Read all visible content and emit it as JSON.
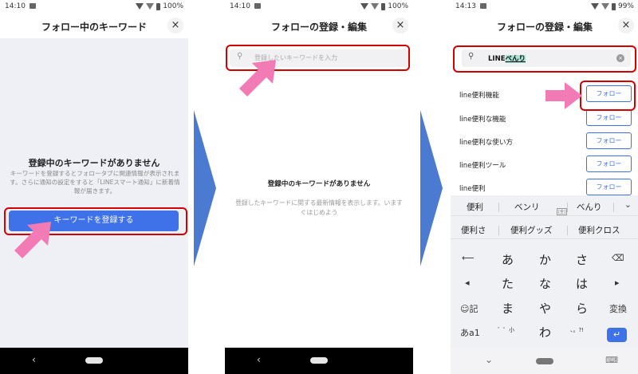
{
  "screen1": {
    "status_time": "14:10",
    "battery": "100%",
    "title": "フォロー中のキーワード",
    "close": "×",
    "empty_title": "登録中のキーワードがありません",
    "empty_desc": "キーワードを登録するとフォロータブに関連情報が表示されます。さらに通知の設定をすると「LINEスマート通知」に新着情報が届きます。",
    "register_button": "キーワードを登録する",
    "nav_back": "‹"
  },
  "screen2": {
    "status_time": "14:10",
    "battery": "100%",
    "title": "フォローの登録・編集",
    "close": "×",
    "search_placeholder": "登録したいキーワードを入力",
    "empty_title": "登録中のキーワードがありません",
    "empty_desc": "登録したキーワードに関する最新情報を表示します。いますぐはじめよう",
    "nav_back": "‹"
  },
  "screen3": {
    "status_time": "14:13",
    "battery": "99%",
    "title": "フォローの登録・編集",
    "close": "×",
    "search_value_prefix": "LINE",
    "search_value_composing": "べんり",
    "results": [
      {
        "keyword": "line便利機能",
        "button": "フォロー"
      },
      {
        "keyword": "line便利な機能",
        "button": "フォロー"
      },
      {
        "keyword": "line便利な使い方",
        "button": "フォロー"
      },
      {
        "keyword": "line便利ツール",
        "button": "フォロー"
      },
      {
        "keyword": "line便利",
        "button": "フォロー"
      }
    ],
    "keyboard": {
      "suggestions_row1": [
        "便利",
        "ベンリ",
        "べんり"
      ],
      "suggestions_row1_tag": "[全]",
      "suggestions_row2": [
        "便利さ",
        "便利グッズ",
        "便利クロス"
      ],
      "keys_row1": [
        "⟵",
        "あ",
        "か",
        "さ",
        "⌫"
      ],
      "keys_row2": [
        "◂",
        "た",
        "な",
        "は",
        "▸"
      ],
      "keys_row3": [
        "☺記",
        "ま",
        "や",
        "ら",
        "変換"
      ],
      "keys_row4": [
        "あa1",
        "゛゜小",
        "わ",
        "、。?!",
        "↵"
      ]
    }
  },
  "colors": {
    "accent_blue": "#3f71e8",
    "highlight_red": "#d40000",
    "pointer_pink": "#f27ab5",
    "step_chevron": "#4a7bd0"
  }
}
